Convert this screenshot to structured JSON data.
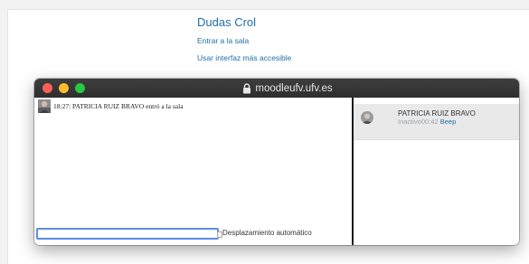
{
  "page": {
    "title": "Dudas Crol",
    "enter_link": "Entrar a la sala",
    "accessible_link": "Usar interfaz más accesible"
  },
  "window": {
    "domain": "moodleufv.ufv.es",
    "lock_icon": "lock-icon"
  },
  "chat": {
    "messages": [
      {
        "time": "18:27",
        "text": "18:27: PATRICIA RUIZ BRAVO entró a la sala"
      }
    ],
    "input_value": "",
    "autoscroll_label": "Desplazamiento automático",
    "autoscroll_checked": false
  },
  "users": [
    {
      "name": "PATRICIA RUIZ BRAVO",
      "status": "Inactivo00:42",
      "beep": "Beep"
    }
  ],
  "colors": {
    "link": "#1f6fa8",
    "titlebar": "#333333",
    "close": "#ff5f57",
    "minimize": "#febc2e",
    "maximize": "#28c840",
    "input_focus": "#5b8fe0"
  }
}
